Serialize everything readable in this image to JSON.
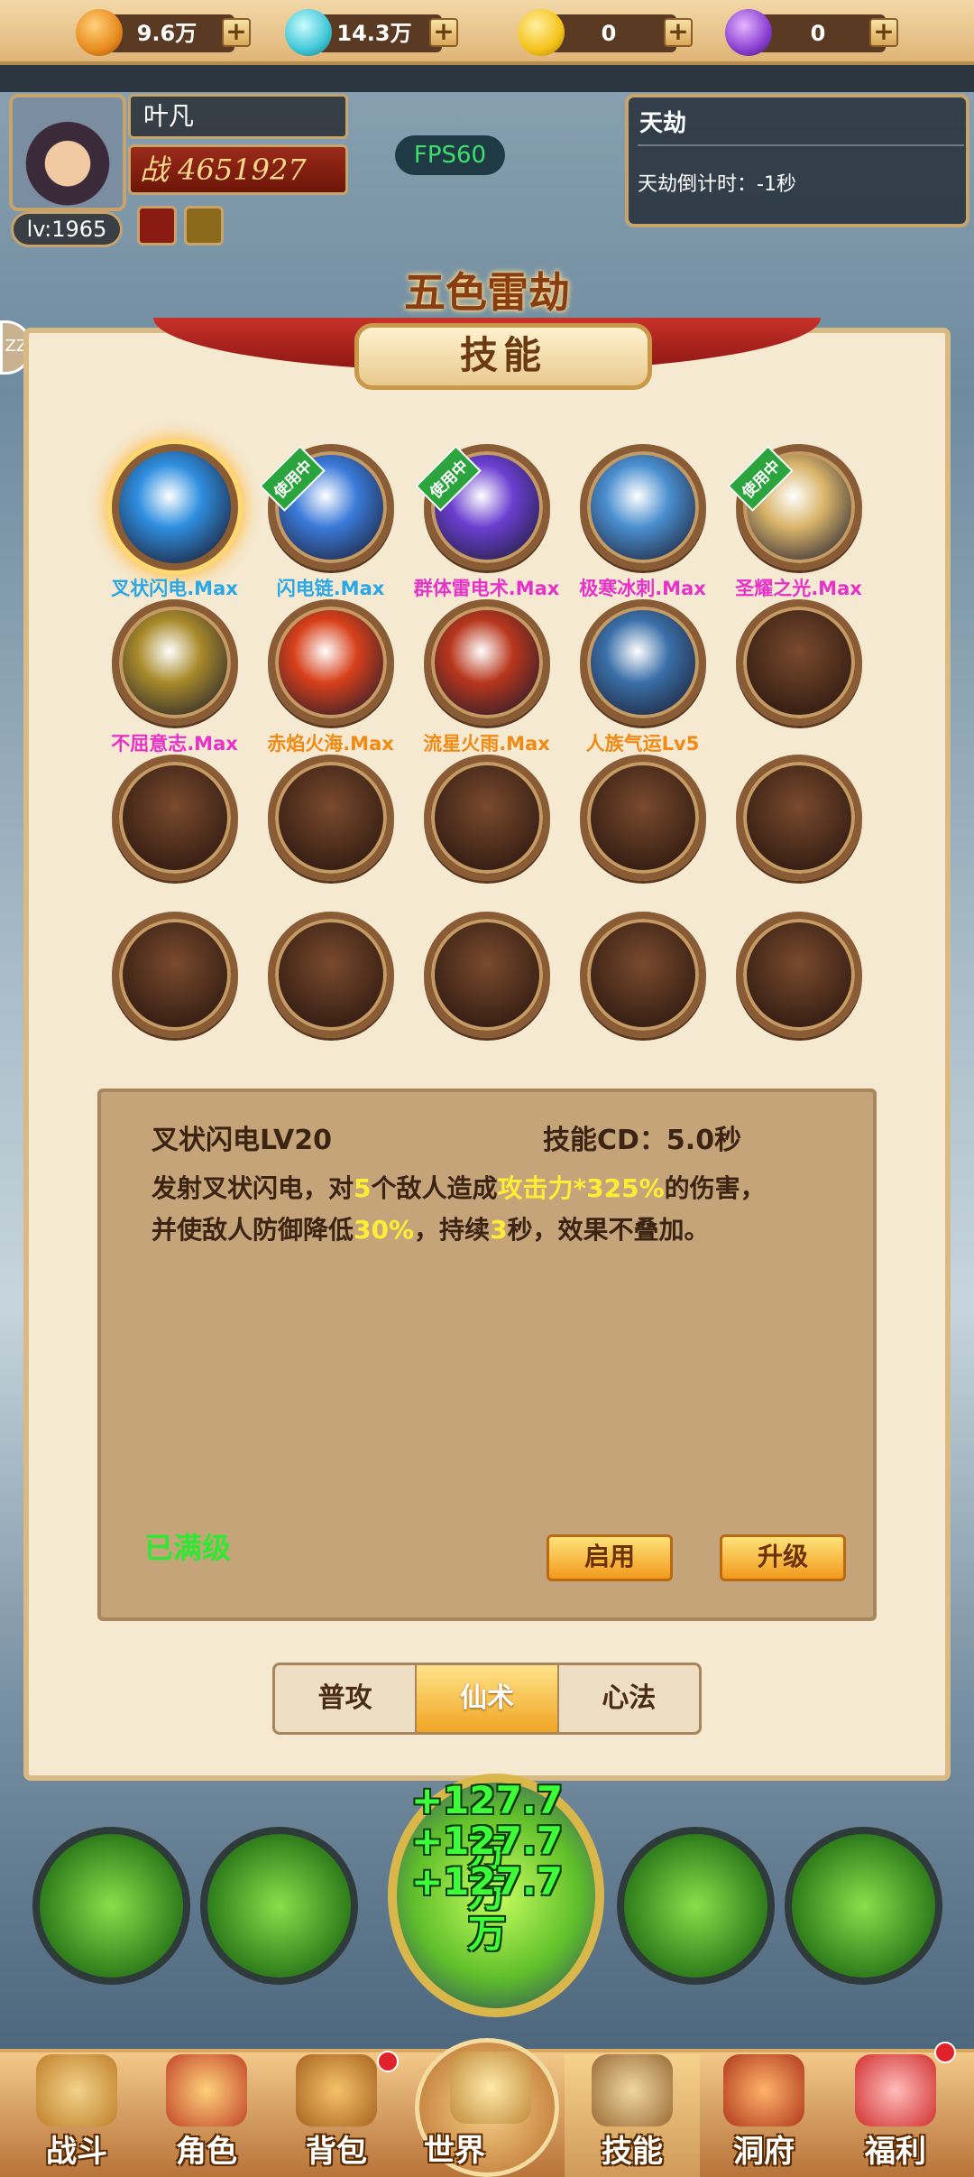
{
  "currencies": [
    {
      "name": "gold-ore",
      "value": "9.6万",
      "color": "#e88a1e"
    },
    {
      "name": "spirit-orb",
      "value": "14.3万",
      "color": "#3fc7d6"
    },
    {
      "name": "ingot",
      "value": "0",
      "color": "#f5c21a"
    },
    {
      "name": "purple-orb",
      "value": "0",
      "color": "#8b3fd0"
    }
  ],
  "plus_label": "+",
  "player": {
    "name": "叶凡",
    "power": "战 4651927",
    "level": "lv:1965"
  },
  "fps": "FPS60",
  "tianjie": {
    "title": "天劫",
    "countdown": "天劫倒计时：-1秒"
  },
  "stage_title": "五色雷劫",
  "panel_title": "技能",
  "side_tab": "ZZ",
  "in_use_label": "使用中",
  "skills": [
    {
      "label": "叉状闪电.Max",
      "color": "#2aa7e6",
      "selected": true,
      "in_use": false,
      "art": "#2f8fe0"
    },
    {
      "label": "闪电链.Max",
      "color": "#2aa7e6",
      "selected": false,
      "in_use": true,
      "art": "#3a7ad9"
    },
    {
      "label": "群体雷电术.Max",
      "color": "#e632c8",
      "selected": false,
      "in_use": true,
      "art": "#6a3fd1"
    },
    {
      "label": "极寒冰刺.Max",
      "color": "#e632c8",
      "selected": false,
      "in_use": false,
      "art": "#4a8fd0"
    },
    {
      "label": "圣耀之光.Max",
      "color": "#e632c8",
      "selected": false,
      "in_use": true,
      "art": "#d9b46a"
    },
    {
      "label": "不屈意志.Max",
      "color": "#e632c8",
      "selected": false,
      "in_use": false,
      "art": "#a88a2a"
    },
    {
      "label": "赤焰火海.Max",
      "color": "#f08a12",
      "selected": false,
      "in_use": false,
      "art": "#d8401a"
    },
    {
      "label": "流星火雨.Max",
      "color": "#f08a12",
      "selected": false,
      "in_use": false,
      "art": "#b8361c"
    },
    {
      "label": "人族气运Lv5",
      "color": "#f08a12",
      "selected": false,
      "in_use": false,
      "art": "#3a6fa8"
    }
  ],
  "detail": {
    "name": "叉状闪电LV20",
    "cd": "技能CD：5.0秒",
    "text_parts": [
      "发射叉状闪电，对",
      "5",
      "个敌人造成",
      "攻击力*325%",
      "的伤害，",
      "并使敌人防御降低",
      "30%",
      "，持续",
      "3",
      "秒，效果不叠加。"
    ],
    "max_status": "已满级",
    "enable_button": "启用",
    "upgrade_button": "升级"
  },
  "tabs": [
    "普攻",
    "仙术",
    "心法"
  ],
  "active_tab": "仙术",
  "damage_numbers": [
    "+127.7万",
    "+127.7万",
    "+127.7万"
  ],
  "nav": [
    {
      "label": "战斗",
      "icon": "crossed-swords-icon",
      "badge": false
    },
    {
      "label": "角色",
      "icon": "character-icon",
      "badge": false
    },
    {
      "label": "背包",
      "icon": "bag-icon",
      "badge": true
    },
    {
      "label": "世界",
      "icon": "world-mountain-icon",
      "badge": false
    },
    {
      "label": "技能",
      "icon": "scroll-icon",
      "badge": false
    },
    {
      "label": "洞府",
      "icon": "mansion-icon",
      "badge": false
    },
    {
      "label": "福利",
      "icon": "gift-icon",
      "badge": true
    }
  ]
}
